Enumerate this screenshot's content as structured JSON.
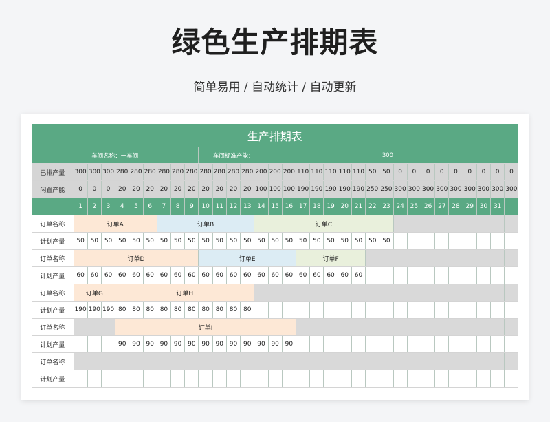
{
  "page": {
    "title": "绿色生产排期表",
    "subtitle": "简单易用 / 自动统计 / 自动更新"
  },
  "sheet": {
    "title": "生产排期表",
    "workshop_label": "车间名称：一车间",
    "capacity_label": "车间标准产能：",
    "capacity_value": "300",
    "scheduled_label": "已排产量",
    "idle_label": "闲置产能",
    "scheduled": [
      "300",
      "300",
      "300",
      "280",
      "280",
      "280",
      "280",
      "280",
      "280",
      "280",
      "280",
      "280",
      "280",
      "200",
      "200",
      "200",
      "110",
      "110",
      "110",
      "110",
      "110",
      "50",
      "50",
      "0",
      "0",
      "0",
      "0",
      "0",
      "0",
      "0",
      "0",
      "0"
    ],
    "idle": [
      "0",
      "0",
      "0",
      "20",
      "20",
      "20",
      "20",
      "20",
      "20",
      "20",
      "20",
      "20",
      "20",
      "100",
      "100",
      "100",
      "190",
      "190",
      "190",
      "190",
      "190",
      "250",
      "250",
      "300",
      "300",
      "300",
      "300",
      "300",
      "300",
      "300",
      "300",
      "300"
    ],
    "days": [
      "1",
      "2",
      "3",
      "4",
      "5",
      "6",
      "7",
      "8",
      "9",
      "10",
      "11",
      "12",
      "13",
      "14",
      "15",
      "16",
      "17",
      "18",
      "19",
      "20",
      "21",
      "22",
      "23",
      "24",
      "25",
      "26",
      "27",
      "28",
      "29",
      "30",
      "31"
    ],
    "rows": [
      {
        "kind": "order",
        "label": "订单名称",
        "segments": [
          {
            "text": "订单A",
            "span": 6,
            "color": "peach"
          },
          {
            "text": "订单B",
            "span": 7,
            "color": "blue"
          },
          {
            "text": "订单C",
            "span": 10,
            "color": "green"
          },
          {
            "text": "",
            "span": 8,
            "color": "gray"
          }
        ]
      },
      {
        "kind": "qty",
        "label": "计划产量",
        "values": [
          "50",
          "50",
          "50",
          "50",
          "50",
          "50",
          "50",
          "50",
          "50",
          "50",
          "50",
          "50",
          "50",
          "50",
          "50",
          "50",
          "50",
          "50",
          "50",
          "50",
          "50",
          "50",
          "50",
          "",
          "",
          "",
          "",
          "",
          "",
          "",
          ""
        ]
      },
      {
        "kind": "order",
        "label": "订单名称",
        "segments": [
          {
            "text": "订单D",
            "span": 9,
            "color": "peach"
          },
          {
            "text": "订单E",
            "span": 7,
            "color": "blue"
          },
          {
            "text": "订单F",
            "span": 5,
            "color": "green"
          },
          {
            "text": "",
            "span": 10,
            "color": "gray"
          }
        ]
      },
      {
        "kind": "qty",
        "label": "计划产量",
        "values": [
          "60",
          "60",
          "60",
          "60",
          "60",
          "60",
          "60",
          "60",
          "60",
          "60",
          "60",
          "60",
          "60",
          "60",
          "60",
          "60",
          "60",
          "60",
          "60",
          "60",
          "60",
          "",
          "",
          "",
          "",
          "",
          "",
          "",
          "",
          "",
          ""
        ]
      },
      {
        "kind": "order",
        "label": "订单名称",
        "segments": [
          {
            "text": "订单G",
            "span": 3,
            "color": "peach"
          },
          {
            "text": "订单H",
            "span": 10,
            "color": "peach"
          },
          {
            "text": "",
            "span": 18,
            "color": "gray"
          }
        ]
      },
      {
        "kind": "qty",
        "label": "计划产量",
        "values": [
          "190",
          "190",
          "190",
          "80",
          "80",
          "80",
          "80",
          "80",
          "80",
          "80",
          "80",
          "80",
          "80",
          "",
          "",
          "",
          "",
          "",
          "",
          "",
          "",
          "",
          "",
          "",
          "",
          "",
          "",
          "",
          "",
          "",
          ""
        ]
      },
      {
        "kind": "order",
        "label": "订单名称",
        "segments": [
          {
            "text": "",
            "span": 3,
            "color": "gray"
          },
          {
            "text": "订单I",
            "span": 13,
            "color": "peach"
          },
          {
            "text": "",
            "span": 15,
            "color": "gray"
          }
        ]
      },
      {
        "kind": "qty",
        "label": "计划产量",
        "values": [
          "",
          "",
          "",
          "90",
          "90",
          "90",
          "90",
          "90",
          "90",
          "90",
          "90",
          "90",
          "90",
          "90",
          "90",
          "90",
          "",
          "",
          "",
          "",
          "",
          "",
          "",
          "",
          "",
          "",
          "",
          "",
          "",
          "",
          ""
        ]
      },
      {
        "kind": "order",
        "label": "订单名称",
        "segments": [
          {
            "text": "",
            "span": 31,
            "color": "gray"
          }
        ]
      },
      {
        "kind": "qty",
        "label": "计划产量",
        "values": [
          "",
          "",
          "",
          "",
          "",
          "",
          "",
          "",
          "",
          "",
          "",
          "",
          "",
          "",
          "",
          "",
          "",
          "",
          "",
          "",
          "",
          "",
          "",
          "",
          "",
          "",
          "",
          "",
          "",
          "",
          ""
        ]
      }
    ]
  }
}
